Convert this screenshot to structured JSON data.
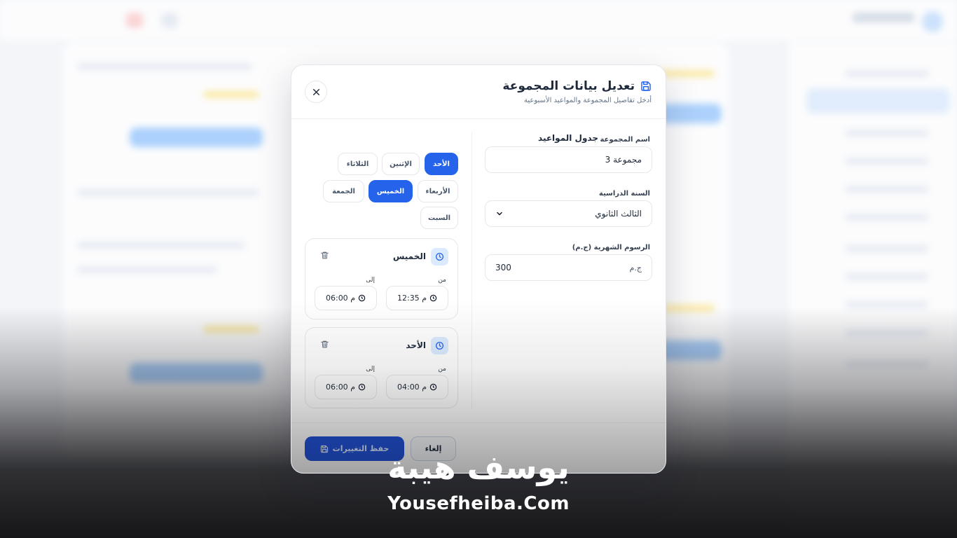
{
  "modal": {
    "title": "تعديل بيانات المجموعة",
    "subtitle": "أدخل تفاصيل المجموعة والمواعيد الأسبوعية",
    "close_icon": "x-icon",
    "title_icon": "save-icon"
  },
  "form": {
    "group_name": {
      "label": "اسم المجموعة",
      "value": "مجموعة 3"
    },
    "school_year": {
      "label": "السنة الدراسية",
      "value": "الثالث الثانوي"
    },
    "monthly_fee": {
      "label": "الرسوم الشهرية (ج.م)",
      "value": "300",
      "unit": "ج.م"
    }
  },
  "schedule": {
    "title": "جدول المواعيد",
    "days": [
      {
        "label": "الأحد",
        "active": true
      },
      {
        "label": "الإثنين",
        "active": false
      },
      {
        "label": "الثلاثاء",
        "active": false
      },
      {
        "label": "الأربعاء",
        "active": false
      },
      {
        "label": "الخميس",
        "active": true
      },
      {
        "label": "الجمعة",
        "active": false
      },
      {
        "label": "السبت",
        "active": false
      }
    ],
    "from_label": "من",
    "to_label": "إلى",
    "slots": [
      {
        "day": "الخميس",
        "from": "12:35 م",
        "to": "06:00 م"
      },
      {
        "day": "الأحد",
        "from": "04:00 م",
        "to": "06:00 م"
      }
    ]
  },
  "footer": {
    "save_label": "حفظ التغييرات",
    "cancel_label": "إلغاء"
  },
  "watermark": {
    "arabic": "يوسف هيبة",
    "latin": "Yousefheiba.Com"
  },
  "colors": {
    "accent": "#2563eb",
    "save_button": "#1d4ed8",
    "clock_bg": "#dbeafe"
  }
}
